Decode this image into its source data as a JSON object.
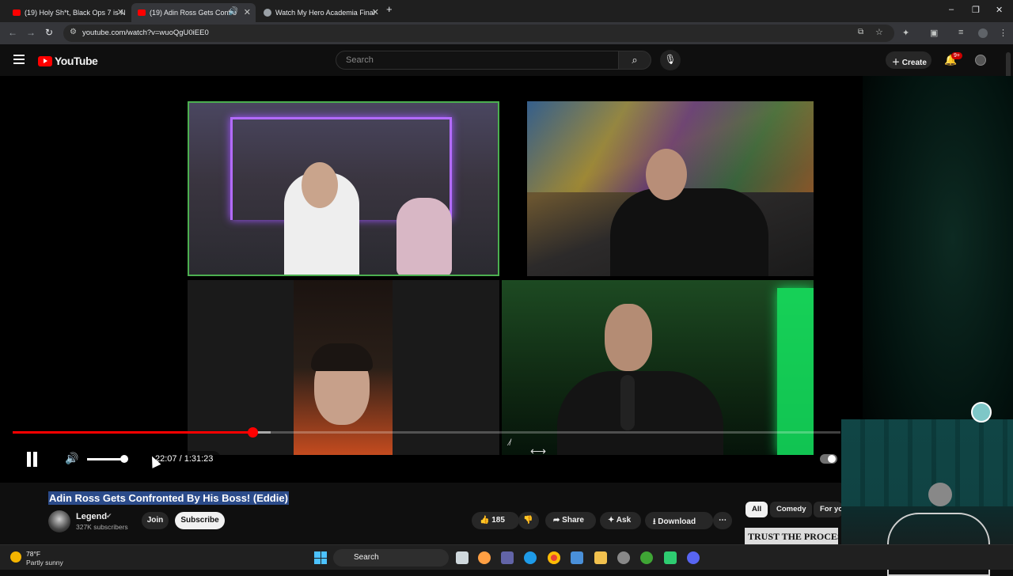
{
  "browser": {
    "tabs": [
      {
        "title": "(19) Holy Sh*t, Black Ops 7 is N",
        "active": false,
        "icon": "youtube-icon"
      },
      {
        "title": "(19) Adin Ross Gets Confro",
        "active": true,
        "icon": "youtube-icon"
      },
      {
        "title": "Watch My Hero Academia Final",
        "active": false,
        "icon": "site-icon"
      }
    ],
    "new_tab": "+",
    "url": "youtube.com/watch?v=wuoQgU0iEE0",
    "window_controls": [
      "–",
      "❐",
      "✕"
    ]
  },
  "youtube": {
    "logo_text": "YouTube",
    "search_placeholder": "Search",
    "create_label": "Create",
    "notification_badge": "9+"
  },
  "player": {
    "current_time": "22:07",
    "duration": "1:31:23",
    "time_display": "22:07 / 1:31:23",
    "progress_fraction": 0.2893,
    "buffered_fraction": 0.3121,
    "volume_fraction": 1.0,
    "state": "playing"
  },
  "video": {
    "title": "Adin Ross Gets Confronted By His Boss! (Eddie)",
    "channel": {
      "name": "Legend",
      "subscribers": "327K subscribers",
      "verified": true
    },
    "join_label": "Join",
    "subscribe_label": "Subscribe",
    "like_count": "185",
    "share_label": "Share",
    "ask_label": "Ask",
    "download_label": "Download"
  },
  "recommendations": {
    "chips": [
      "All",
      "Comedy",
      "For yo"
    ],
    "selected_chip": "All",
    "thumbnail_text": "TRUST THE PROCESS"
  },
  "taskbar": {
    "weather_temp": "78°F",
    "weather_desc": "Partly sunny",
    "search_label": "Search"
  },
  "colors": {
    "accent_red": "#ff0000",
    "background": "#0f0f0f",
    "cam_highlight_border": "#4caf50"
  }
}
